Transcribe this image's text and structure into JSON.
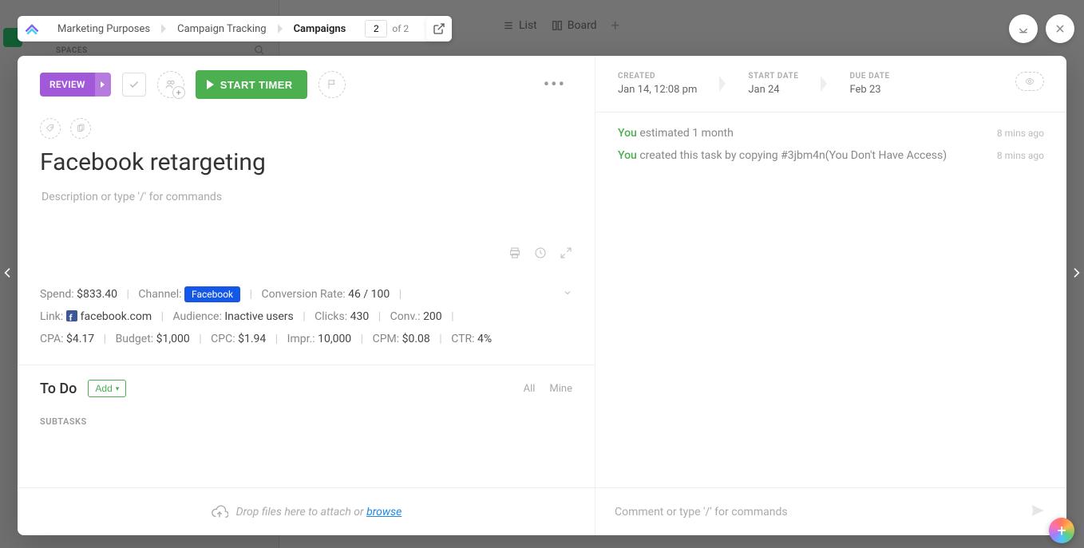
{
  "bg": {
    "spaces_label": "SPACES",
    "list_tab": "List",
    "board_tab": "Board"
  },
  "breadcrumb": {
    "items": [
      "Marketing Purposes",
      "Campaign Tracking",
      "Campaigns"
    ],
    "page_current": "2",
    "page_total": "of 2"
  },
  "task": {
    "status": "REVIEW",
    "timer_label": "START TIMER",
    "title": "Facebook retargeting",
    "description_placeholder": "Description or type '/' for commands"
  },
  "fields": {
    "spend": {
      "label": "Spend:",
      "value": "$833.40"
    },
    "channel": {
      "label": "Channel:",
      "badge": "Facebook"
    },
    "conv_rate": {
      "label": "Conversion Rate:",
      "value": "46 / 100"
    },
    "link": {
      "label": "Link:",
      "value": "facebook.com"
    },
    "audience": {
      "label": "Audience:",
      "value": "Inactive users"
    },
    "clicks": {
      "label": "Clicks:",
      "value": "430"
    },
    "conv": {
      "label": "Conv.:",
      "value": "200"
    },
    "cpa": {
      "label": "CPA:",
      "value": "$4.17"
    },
    "budget": {
      "label": "Budget:",
      "value": "$1,000"
    },
    "cpc": {
      "label": "CPC:",
      "value": "$1.94"
    },
    "impr": {
      "label": "Impr.:",
      "value": "10,000"
    },
    "cpm": {
      "label": "CPM:",
      "value": "$0.08"
    },
    "ctr": {
      "label": "CTR:",
      "value": "4%"
    }
  },
  "todo": {
    "heading": "To Do",
    "add_label": "Add",
    "tab_all": "All",
    "tab_mine": "Mine",
    "subtasks_label": "SUBTASKS"
  },
  "dropzone": {
    "text": "Drop files here to attach or ",
    "browse": "browse"
  },
  "meta": {
    "created_label": "CREATED",
    "created_value": "Jan 14, 12:08 pm",
    "start_label": "START DATE",
    "start_value": "Jan 24",
    "due_label": "DUE DATE",
    "due_value": "Feb 23"
  },
  "activity": [
    {
      "you": "You",
      "text": " estimated 1 month",
      "time": "8 mins ago"
    },
    {
      "you": "You",
      "text": " created this task by copying #3jbm4n(You Don't Have Access)",
      "time": "8 mins ago"
    }
  ],
  "comment_placeholder": "Comment or type '/' for commands"
}
